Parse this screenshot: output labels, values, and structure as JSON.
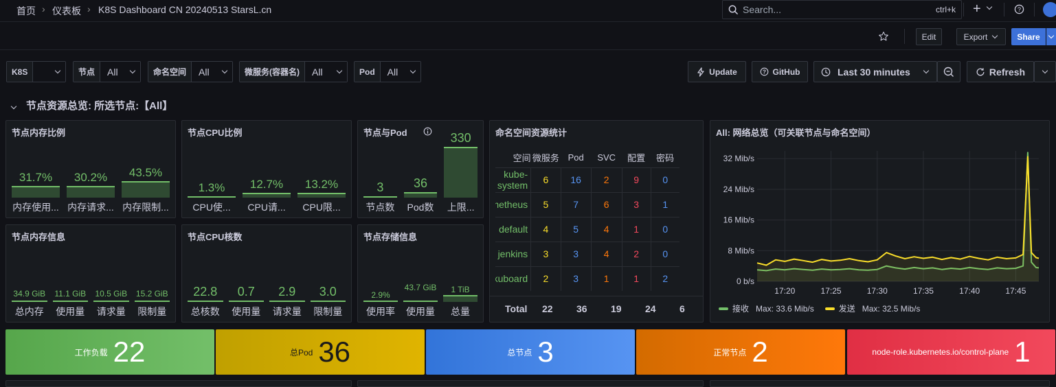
{
  "breadcrumbs": [
    "首页",
    "仪表板",
    "K8S Dashboard CN 20240513 StarsL.cn"
  ],
  "search": {
    "placeholder": "Search...",
    "shortcut": "ctrl+k"
  },
  "toolbar": {
    "plus_label": "+",
    "edit_label": "Edit",
    "export_label": "Export",
    "share_label": "Share"
  },
  "variables": [
    {
      "label": "K8S",
      "value": ""
    },
    {
      "label": "节点",
      "value": "All"
    },
    {
      "label": "命名空间",
      "value": "All"
    },
    {
      "label": "微服务(容器名)",
      "value": "All"
    },
    {
      "label": "Pod",
      "value": "All"
    }
  ],
  "actions": {
    "update_label": "Update",
    "github_label": "GitHub",
    "time_range": "Last 30 minutes",
    "refresh_label": "Refresh"
  },
  "row_title": "节点资源总览: 所选节点:【All】",
  "panels": {
    "mem_ratio": {
      "title": "节点内存比例",
      "gauges": [
        {
          "value": "31.7%",
          "label": "内存使用...",
          "fill": 0.317
        },
        {
          "value": "30.2%",
          "label": "内存请求...",
          "fill": 0.302
        },
        {
          "value": "43.5%",
          "label": "内存限制...",
          "fill": 0.435
        }
      ]
    },
    "cpu_ratio": {
      "title": "节点CPU比例",
      "gauges": [
        {
          "value": "1.3%",
          "label": "CPU使...",
          "fill": 0.013
        },
        {
          "value": "12.7%",
          "label": "CPU请...",
          "fill": 0.127
        },
        {
          "value": "13.2%",
          "label": "CPU限...",
          "fill": 0.132
        }
      ]
    },
    "node_pod": {
      "title": "节点与Pod",
      "gauges": [
        {
          "value": "3",
          "label": "节点数",
          "fill": 0.01
        },
        {
          "value": "36",
          "label": "Pod数",
          "fill": 0.11
        },
        {
          "value": "330",
          "label": "上限...",
          "fill": 1.0
        }
      ]
    },
    "mem_info": {
      "title": "节点内存信息",
      "gauges": [
        {
          "value": "34.9 GiB",
          "label": "总内存",
          "fill": 0.0
        },
        {
          "value": "11.1 GiB",
          "label": "使用量",
          "fill": 0.0
        },
        {
          "value": "10.5 GiB",
          "label": "请求量",
          "fill": 0.0
        },
        {
          "value": "15.2 GiB",
          "label": "限制量",
          "fill": 0.0
        }
      ]
    },
    "cpu_cores": {
      "title": "节点CPU核数",
      "gauges": [
        {
          "value": "22.8",
          "label": "总核数",
          "fill": 0.0
        },
        {
          "value": "0.7",
          "label": "使用量",
          "fill": 0.0
        },
        {
          "value": "2.9",
          "label": "请求量",
          "fill": 0.0
        },
        {
          "value": "3.0",
          "label": "限制量",
          "fill": 0.0
        }
      ]
    },
    "storage": {
      "title": "节点存储信息",
      "gauges": [
        {
          "value": "2.9%",
          "label": "使用率",
          "fill": 0.0
        },
        {
          "value": "43.7 GiB",
          "label": "使用量",
          "fill": 0.04
        },
        {
          "value": "1 TiB",
          "label": "总量",
          "fill": 1.0
        }
      ]
    },
    "ns_stats": {
      "title": "命名空间资源统计",
      "columns": [
        "空间",
        "微服务",
        "Pod",
        "SVC",
        "配置",
        "密码"
      ],
      "rows": [
        [
          "kube-system",
          "6",
          "16",
          "2",
          "9",
          "0"
        ],
        [
          "prometheus",
          "5",
          "7",
          "6",
          "3",
          "1"
        ],
        [
          "default",
          "4",
          "5",
          "4",
          "1",
          "0"
        ],
        [
          "jenkins",
          "3",
          "3",
          "4",
          "2",
          "0"
        ],
        [
          "kuboard",
          "2",
          "3",
          "1",
          "1",
          "2"
        ]
      ],
      "total": [
        "Total",
        "22",
        "36",
        "19",
        "24",
        "6"
      ],
      "col_colors": [
        "#73bf69",
        "#fade2a",
        "#5794f2",
        "#ff780a",
        "#f2495c",
        "#5794f2"
      ]
    },
    "network": {
      "title": "All: 网络总览（可关联节点与命名空间）"
    }
  },
  "chart_data": {
    "type": "line",
    "ylim": [
      0,
      34
    ],
    "y_ticks": [
      "0 b/s",
      "8 Mib/s",
      "16 Mib/s",
      "24 Mib/s",
      "32 Mib/s"
    ],
    "y_tick_values": [
      0,
      8,
      16,
      24,
      32
    ],
    "x_ticks": [
      "17:20",
      "17:25",
      "17:30",
      "17:35",
      "17:40",
      "17:45"
    ],
    "x_tick_values": [
      3,
      8,
      13,
      18,
      23,
      28
    ],
    "x_range": [
      0,
      30.5
    ],
    "series": [
      {
        "name": "接收",
        "color": "#73bf69",
        "legend": "Max: 33.6 Mib/s",
        "x": [
          0,
          1,
          2,
          3,
          4,
          5,
          6,
          7,
          8,
          9,
          10,
          11,
          12,
          13,
          14,
          15,
          16,
          17,
          18,
          19,
          20,
          21,
          22,
          23,
          24,
          25,
          26,
          27,
          28,
          28.8,
          29.3,
          29.7,
          30.2,
          30.5
        ],
        "y": [
          3.0,
          2.8,
          3.2,
          3.0,
          3.3,
          3.1,
          2.9,
          3.2,
          3.0,
          3.1,
          3.3,
          3.0,
          2.9,
          3.1,
          4.0,
          3.5,
          3.2,
          3.6,
          3.3,
          3.5,
          3.1,
          3.4,
          3.2,
          3.6,
          3.3,
          3.1,
          3.5,
          3.3,
          3.4,
          4.0,
          33.6,
          5.0,
          3.6,
          3.5
        ]
      },
      {
        "name": "发送",
        "color": "#fade2a",
        "legend": "Max: 32.5 Mib/s",
        "x": [
          0,
          1,
          2,
          3,
          4,
          5,
          6,
          7,
          8,
          9,
          10,
          11,
          12,
          13,
          14,
          15,
          16,
          17,
          18,
          19,
          20,
          21,
          22,
          23,
          24,
          25,
          26,
          27,
          28,
          28.8,
          29.3,
          29.7,
          30.2,
          30.5
        ],
        "y": [
          4.8,
          4.2,
          5.6,
          5.2,
          5.8,
          5.4,
          5.0,
          5.7,
          5.3,
          5.5,
          5.9,
          5.4,
          5.1,
          5.6,
          7.5,
          6.6,
          5.9,
          6.4,
          6.0,
          6.3,
          5.7,
          6.2,
          5.8,
          6.5,
          6.0,
          5.6,
          6.3,
          5.9,
          6.1,
          7.0,
          32.5,
          7.5,
          6.2,
          6.0
        ]
      }
    ]
  },
  "stats": [
    {
      "label": "工作负载",
      "value": "22",
      "bg": "linear-gradient(90deg,#56a64b,#73bf69)"
    },
    {
      "label": "总Pod",
      "value": "36",
      "bg": "linear-gradient(90deg,#c0a000,#e0b400)"
    },
    {
      "label": "总节点",
      "value": "3",
      "bg": "linear-gradient(90deg,#3274d9,#5794f2)"
    },
    {
      "label": "正常节点",
      "value": "2",
      "bg": "linear-gradient(90deg,#d36b00,#ff780a)"
    },
    {
      "label": "node-role.kubernetes.io/control-plane",
      "value": "1",
      "bg": "linear-gradient(90deg,#e02f44,#f2495c)"
    }
  ]
}
